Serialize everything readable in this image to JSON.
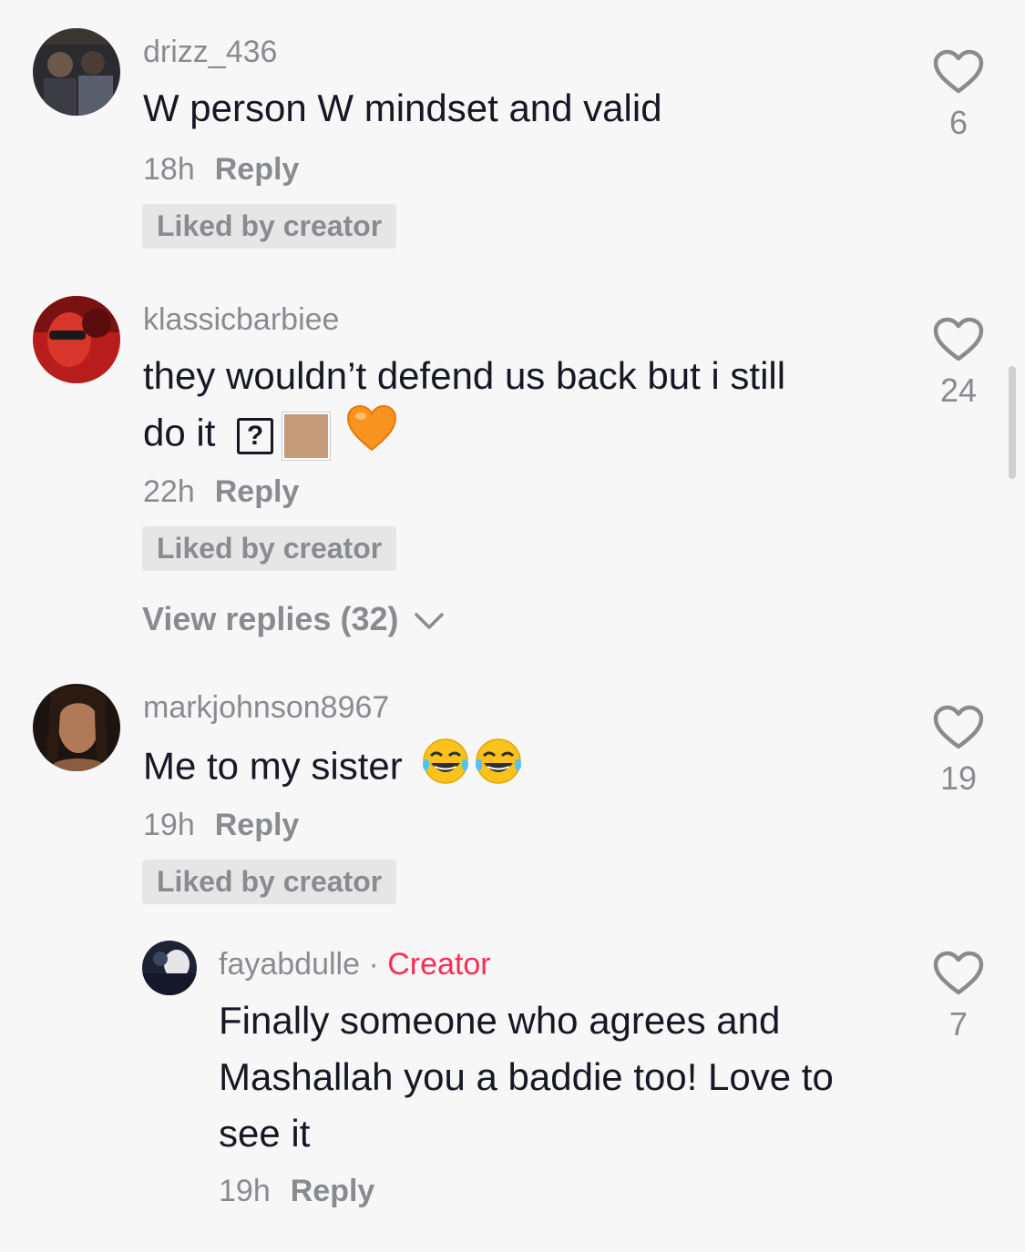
{
  "comments": [
    {
      "username": "drizz_436",
      "text": "W person W mindset and valid",
      "time": "18h",
      "reply_label": "Reply",
      "liked_by_creator": "Liked by creator",
      "like_count": "6"
    },
    {
      "username": "klassicbarbiee",
      "text_line1": "they wouldn’t defend us back but i still",
      "text_line2": "do it",
      "unknown_glyph": "?",
      "time": "22h",
      "reply_label": "Reply",
      "liked_by_creator": "Liked by creator",
      "like_count": "24",
      "view_replies": "View replies (32)"
    },
    {
      "username": "markjohnson8967",
      "text": "Me to my sister",
      "time": "19h",
      "reply_label": "Reply",
      "liked_by_creator": "Liked by creator",
      "like_count": "19"
    }
  ],
  "reply": {
    "username": "fayabdulle",
    "separator": "·",
    "creator_label": "Creator",
    "text_line1": "Finally someone who agrees and",
    "text_line2": "Mashallah you a baddie too! Love to",
    "text_line3": "see it",
    "time": "19h",
    "reply_label": "Reply",
    "like_count": "7"
  },
  "colors": {
    "background": "#f7f7f7",
    "secondary_text": "#8a8b91",
    "creator_accent": "#fe2c55",
    "orange_heart": "#f7931e"
  },
  "icons": [
    "heart-outline-icon",
    "chevron-down-icon",
    "laughing-emoji",
    "orange-heart-emoji",
    "skin-tone-swatch"
  ]
}
